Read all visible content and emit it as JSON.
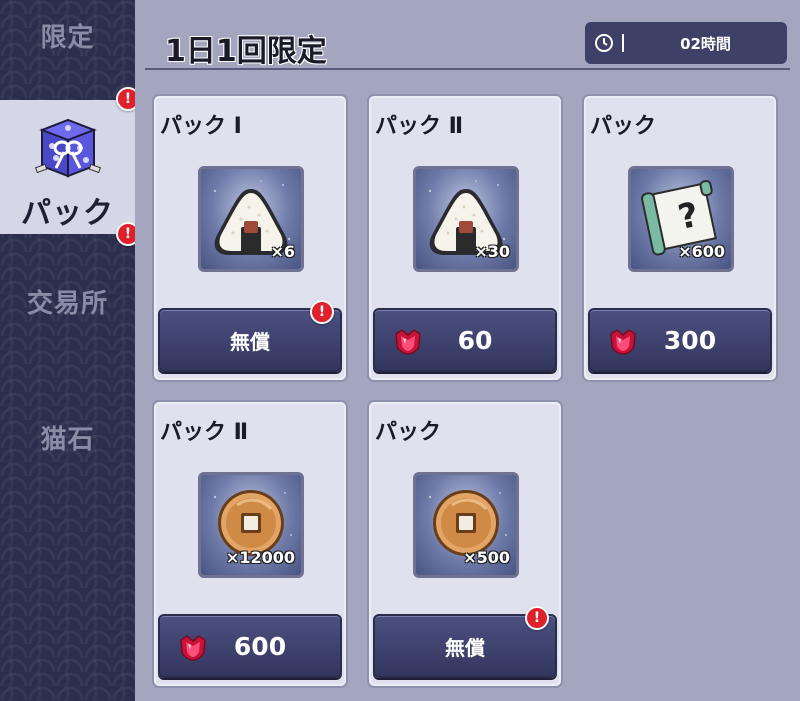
{
  "sidebar": {
    "items": [
      {
        "label": "限定"
      },
      {
        "label": "パック"
      },
      {
        "label": "交易所"
      },
      {
        "label": "猫石"
      }
    ]
  },
  "alerts": {
    "mark": "!"
  },
  "header": {
    "title": "1日1回限定",
    "timer": "02時間"
  },
  "cards": [
    {
      "name": "パック Ⅰ",
      "item": "onigiri-icon",
      "qty": "×6",
      "price": "無償",
      "currency": "free"
    },
    {
      "name": "パック Ⅱ",
      "item": "onigiri-icon",
      "qty": "×30",
      "price": "60",
      "currency": "gem"
    },
    {
      "name": "パック",
      "item": "scroll-icon",
      "qty": "×600",
      "price": "300",
      "currency": "gem"
    },
    {
      "name": "パック Ⅱ",
      "item": "coin-icon",
      "qty": "×12000",
      "price": "600",
      "currency": "gem"
    },
    {
      "name": "パック",
      "item": "coin-icon",
      "qty": "×500",
      "price": "無償",
      "currency": "free"
    }
  ],
  "colors": {
    "sidebar_bg": "#2c2e4e",
    "main_bg": "#a3a6be",
    "button_bg": "#3d4067",
    "alert": "#e0212c",
    "gem": "#e8345a"
  }
}
